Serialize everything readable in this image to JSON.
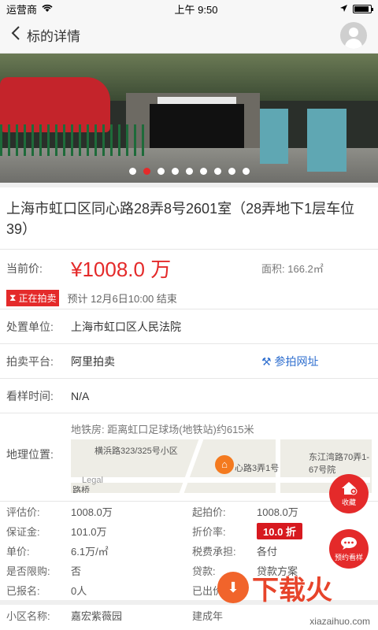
{
  "status": {
    "carrier": "运营商",
    "time": "上午 9:50"
  },
  "nav": {
    "title": "标的详情"
  },
  "banner": {
    "dot_count": 9,
    "active_dot": 1
  },
  "property": {
    "title": "上海市虹口区同心路28弄8号2601室（28弄地下1层车位39）"
  },
  "price": {
    "label": "当前价:",
    "value": "¥1008.0 万",
    "area_label": "面积:",
    "area_value": "166.2㎡"
  },
  "auction": {
    "status": "正在拍卖",
    "end_time": "预计 12月6日10:00 结束"
  },
  "info": {
    "disposal_label": "处置单位:",
    "disposal_value": "上海市虹口区人民法院",
    "platform_label": "拍卖平台:",
    "platform_value": "阿里拍卖",
    "platform_link": "参拍网址",
    "view_label": "看样时间:",
    "view_value": "N/A",
    "location_label": "地理位置:",
    "location_hint": "地铁房: 距离虹口足球场(地铁站)约615米"
  },
  "map": {
    "label1": "横浜路323/325号小区",
    "label2": "心路3弄1号",
    "label3": "东江湾路70弄1-67号院",
    "label4": "Legal",
    "label5": "路桥"
  },
  "grid": [
    {
      "l1": "评估价:",
      "v1": "1008.0万",
      "l2": "起拍价:",
      "v2": "1008.0万"
    },
    {
      "l1": "保证金:",
      "v1": "101.0万",
      "l2": "折价率:",
      "v2": "10.0 折"
    },
    {
      "l1": "单价:",
      "v1": "6.1万/㎡",
      "l2": "税费承担:",
      "v2": "各付"
    },
    {
      "l1": "是否限购:",
      "v1": "否",
      "l2": "贷款:",
      "v2": "贷款方案"
    },
    {
      "l1": "已报名:",
      "v1": "0人",
      "l2": "已出价:",
      "v2": ""
    }
  ],
  "bottom": {
    "community_label": "小区名称:",
    "community_value": "嘉宏紫薇园",
    "built_label": "建成年"
  },
  "fab": {
    "favorite": "收藏",
    "appointment": "预约看样"
  },
  "watermark": {
    "text": "下载火",
    "url": "xiazaihuo.com"
  },
  "colors": {
    "accent": "#e42a2a",
    "link": "#2f6fcf"
  }
}
